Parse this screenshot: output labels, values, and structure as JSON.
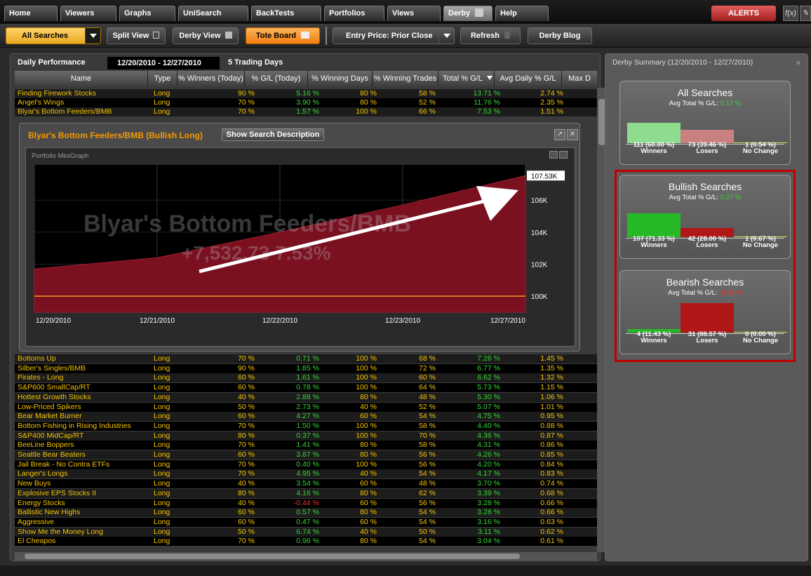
{
  "tabs": [
    "Home",
    "Viewers",
    "Graphs",
    "UniSearch",
    "BackTests",
    "Portfolios",
    "Views",
    "Derby",
    "Help"
  ],
  "alerts_label": "ALERTS",
  "fx_label": "f(x)",
  "toolbar": {
    "all_searches": "All Searches",
    "split_view": "Split View",
    "derby_view": "Derby View",
    "tote_board": "Tote Board",
    "entry_price": "Entry Price: Prior Close",
    "refresh": "Refresh",
    "derby_blog": "Derby Blog"
  },
  "performance": {
    "label": "Daily Performance",
    "date_range": "12/20/2010 - 12/27/2010",
    "trading_days": "5 Trading Days"
  },
  "columns": [
    "Name",
    "Type",
    "% Winners (Today)",
    "% G/L (Today)",
    "% Winning Days",
    "% Winning Trades",
    "Total % G/L",
    "Avg Daily % G/L",
    "Max D"
  ],
  "top_rows": [
    {
      "name": "Finding Firework Stocks",
      "type": "Long",
      "winners": "90 %",
      "gl": "5.16 %",
      "wdays": "80 %",
      "wtrades": "58 %",
      "total": "13.71 %",
      "avg": "2.74 %"
    },
    {
      "name": "Angel's Wings",
      "type": "Long",
      "winners": "70 %",
      "gl": "3.90 %",
      "wdays": "80 %",
      "wtrades": "52 %",
      "total": "11.76 %",
      "avg": "2.35 %"
    },
    {
      "name": "Blyar's Bottom Feeders/BMB",
      "type": "Long",
      "winners": "70 %",
      "gl": "1.57 %",
      "wdays": "100 %",
      "wtrades": "66 %",
      "total": "7.53 %",
      "avg": "1.51 %"
    }
  ],
  "detail": {
    "title": "Blyar's Bottom Feeders/BMB (Bullish Long)",
    "show_description": "Show Search Description",
    "chart_title": "Portfolio MiniGraph",
    "watermark_name": "Blyar's Bottom Feeders/BMB",
    "watermark_value": "+7,532.73 7.53%"
  },
  "chart_data": {
    "type": "area",
    "x": [
      "12/20/2010",
      "12/21/2010",
      "12/22/2010",
      "12/23/2010",
      "12/27/2010"
    ],
    "values": [
      101700,
      102400,
      104000,
      105700,
      107530
    ],
    "baseline": 100000,
    "ylim": [
      99000,
      108200
    ],
    "yticks": [
      "100K",
      "102K",
      "104K",
      "106K"
    ],
    "last_label": "107.53K",
    "series_color": "#7a1020"
  },
  "rows": [
    {
      "name": "Bottoms Up",
      "type": "Long",
      "winners": "70 %",
      "gl": "0.71 %",
      "wdays": "100 %",
      "wtrades": "68 %",
      "total": "7.26 %",
      "avg": "1.45 %"
    },
    {
      "name": "Silber's Singles/BMB",
      "type": "Long",
      "winners": "90 %",
      "gl": "1.85 %",
      "wdays": "100 %",
      "wtrades": "72 %",
      "total": "6.77 %",
      "avg": "1.35 %"
    },
    {
      "name": "Pirates - Long",
      "type": "Long",
      "winners": "60 %",
      "gl": "1.61 %",
      "wdays": "100 %",
      "wtrades": "60 %",
      "total": "6.62 %",
      "avg": "1.32 %"
    },
    {
      "name": "S&P600 SmallCap/RT",
      "type": "Long",
      "winners": "60 %",
      "gl": "0.78 %",
      "wdays": "100 %",
      "wtrades": "64 %",
      "total": "5.73 %",
      "avg": "1.15 %"
    },
    {
      "name": "Hottest Growth Stocks",
      "type": "Long",
      "winners": "40 %",
      "gl": "2.88 %",
      "wdays": "80 %",
      "wtrades": "48 %",
      "total": "5.30 %",
      "avg": "1.06 %"
    },
    {
      "name": "Low-Priced Spikers",
      "type": "Long",
      "winners": "50 %",
      "gl": "2.73 %",
      "wdays": "40 %",
      "wtrades": "52 %",
      "total": "5.07 %",
      "avg": "1.01 %"
    },
    {
      "name": "Bear Market Burner",
      "type": "Long",
      "winners": "60 %",
      "gl": "4.27 %",
      "wdays": "60 %",
      "wtrades": "54 %",
      "total": "4.75 %",
      "avg": "0.95 %"
    },
    {
      "name": "Bottom Fishing in Rising Industries",
      "type": "Long",
      "winners": "70 %",
      "gl": "1.50 %",
      "wdays": "100 %",
      "wtrades": "58 %",
      "total": "4.40 %",
      "avg": "0.88 %"
    },
    {
      "name": "S&P400 MidCap/RT",
      "type": "Long",
      "winners": "80 %",
      "gl": "0.37 %",
      "wdays": "100 %",
      "wtrades": "70 %",
      "total": "4.36 %",
      "avg": "0.87 %"
    },
    {
      "name": "BeeLine Boppers",
      "type": "Long",
      "winners": "70 %",
      "gl": "1.41 %",
      "wdays": "80 %",
      "wtrades": "58 %",
      "total": "4.31 %",
      "avg": "0.86 %"
    },
    {
      "name": "Seattle Bear Beaters",
      "type": "Long",
      "winners": "60 %",
      "gl": "3.87 %",
      "wdays": "80 %",
      "wtrades": "56 %",
      "total": "4.26 %",
      "avg": "0.85 %"
    },
    {
      "name": "Jail Break - No Contra ETFs",
      "type": "Long",
      "winners": "70 %",
      "gl": "0.40 %",
      "wdays": "100 %",
      "wtrades": "56 %",
      "total": "4.20 %",
      "avg": "0.84 %"
    },
    {
      "name": "Langer's Longs",
      "type": "Long",
      "winners": "70 %",
      "gl": "4.95 %",
      "wdays": "40 %",
      "wtrades": "54 %",
      "total": "4.17 %",
      "avg": "0.83 %"
    },
    {
      "name": "New Buys",
      "type": "Long",
      "winners": "40 %",
      "gl": "3.54 %",
      "wdays": "60 %",
      "wtrades": "48 %",
      "total": "3.70 %",
      "avg": "0.74 %"
    },
    {
      "name": "Explosive EPS Stocks II",
      "type": "Long",
      "winners": "80 %",
      "gl": "4.16 %",
      "wdays": "80 %",
      "wtrades": "62 %",
      "total": "3.39 %",
      "avg": "0.68 %"
    },
    {
      "name": "Energy Stocks",
      "type": "Long",
      "winners": "40 %",
      "gl": "-0.44 %",
      "wdays": "60 %",
      "wtrades": "56 %",
      "total": "3.28 %",
      "avg": "0.66 %"
    },
    {
      "name": "Ballistic New Highs",
      "type": "Long",
      "winners": "60 %",
      "gl": "0.57 %",
      "wdays": "80 %",
      "wtrades": "54 %",
      "total": "3.28 %",
      "avg": "0.66 %"
    },
    {
      "name": "Aggressive",
      "type": "Long",
      "winners": "60 %",
      "gl": "0.47 %",
      "wdays": "60 %",
      "wtrades": "54 %",
      "total": "3.16 %",
      "avg": "0.63 %"
    },
    {
      "name": "Show Me the Money Long",
      "type": "Long",
      "winners": "50 %",
      "gl": "6.74 %",
      "wdays": "40 %",
      "wtrades": "50 %",
      "total": "3.11 %",
      "avg": "0.62 %"
    },
    {
      "name": "El Cheapos",
      "type": "Long",
      "winners": "70 %",
      "gl": "0.96 %",
      "wdays": "80 %",
      "wtrades": "54 %",
      "total": "3.04 %",
      "avg": "0.61 %"
    }
  ],
  "summary": {
    "title": "Derby Summary (12/20/2010 - 12/27/2010)",
    "cards": [
      {
        "title": "All Searches",
        "avg_label": "Avg Total % G/L:",
        "avg_value": "0.17 %",
        "winners": "111 (60.00 %)",
        "losers": "73 (39.46 %)",
        "nochange": "1 (0.54 %)",
        "winners_pct": 60.0,
        "losers_pct": 39.46,
        "nochange_pct": 0.54
      },
      {
        "title": "Bullish Searches",
        "avg_label": "Avg Total % G/L:",
        "avg_value": "0.27 %",
        "winners": "107 (71.33 %)",
        "losers": "42 (28.00 %)",
        "nochange": "1 (0.67 %)",
        "winners_pct": 71.33,
        "losers_pct": 28.0,
        "nochange_pct": 0.67
      },
      {
        "title": "Bearish Searches",
        "avg_label": "Avg Total % G/L:",
        "avg_value": "-0.81 %",
        "winners": "4 (11.43 %)",
        "losers": "31 (88.57 %)",
        "nochange": "0 (0.00 %)",
        "winners_pct": 11.43,
        "losers_pct": 88.57,
        "nochange_pct": 0.0
      }
    ],
    "winners_label": "Winners",
    "losers_label": "Losers",
    "nochange_label": "No Change"
  }
}
